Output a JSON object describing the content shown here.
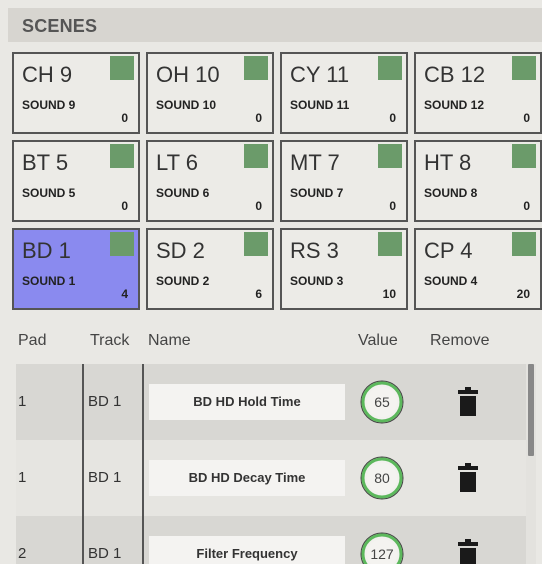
{
  "header": {
    "title": "SCENES"
  },
  "pads": [
    {
      "name": "CH 9",
      "sound": "SOUND 9",
      "value": "0"
    },
    {
      "name": "OH 10",
      "sound": "SOUND 10",
      "value": "0"
    },
    {
      "name": "CY 11",
      "sound": "SOUND 11",
      "value": "0"
    },
    {
      "name": "CB 12",
      "sound": "SOUND 12",
      "value": "0"
    },
    {
      "name": "BT 5",
      "sound": "SOUND 5",
      "value": "0"
    },
    {
      "name": "LT 6",
      "sound": "SOUND 6",
      "value": "0"
    },
    {
      "name": "MT 7",
      "sound": "SOUND 7",
      "value": "0"
    },
    {
      "name": "HT 8",
      "sound": "SOUND 8",
      "value": "0"
    },
    {
      "name": "BD 1",
      "sound": "SOUND 1",
      "value": "4"
    },
    {
      "name": "SD 2",
      "sound": "SOUND 2",
      "value": "6"
    },
    {
      "name": "RS 3",
      "sound": "SOUND 3",
      "value": "10"
    },
    {
      "name": "CP 4",
      "sound": "SOUND 4",
      "value": "20"
    }
  ],
  "selected_pad": "BD 1",
  "colors": {
    "accent_selected": "#8a8aef",
    "indicator": "#6b9b6a",
    "knob_ring": "#4caf50"
  },
  "table": {
    "columns": {
      "pad": "Pad",
      "track": "Track",
      "name": "Name",
      "value": "Value",
      "remove": "Remove"
    },
    "rows": [
      {
        "pad": "1",
        "track": "BD 1",
        "name": "BD HD Hold Time",
        "value": "65",
        "remove_icon": "trash-icon"
      },
      {
        "pad": "1",
        "track": "BD 1",
        "name": "BD HD Decay Time",
        "value": "80",
        "remove_icon": "trash-icon"
      },
      {
        "pad": "2",
        "track": "BD 1",
        "name": "Filter Frequency",
        "value": "127",
        "remove_icon": "trash-icon"
      }
    ]
  }
}
